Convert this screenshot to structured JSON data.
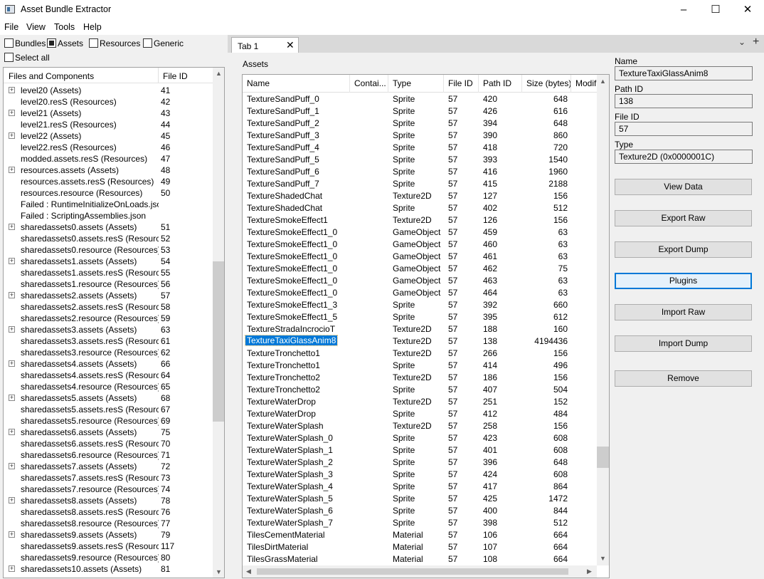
{
  "window": {
    "title": "Asset Bundle Extractor",
    "minimize": "–",
    "maximize": "☐",
    "close": "✕"
  },
  "menu": [
    "File",
    "View",
    "Tools",
    "Help"
  ],
  "filters": {
    "bundles": "Bundles",
    "assets": "Assets",
    "resources": "Resources",
    "generic": "Generic",
    "select_all": "Select all"
  },
  "tree": {
    "headers": {
      "name": "Files and Components",
      "fileid": "File ID"
    },
    "rows": [
      {
        "name": "level20 (Assets)",
        "id": "41",
        "exp": true
      },
      {
        "name": "level20.resS (Resources)",
        "id": "42",
        "exp": false
      },
      {
        "name": "level21 (Assets)",
        "id": "43",
        "exp": true
      },
      {
        "name": "level21.resS (Resources)",
        "id": "44",
        "exp": false
      },
      {
        "name": "level22 (Assets)",
        "id": "45",
        "exp": true
      },
      {
        "name": "level22.resS (Resources)",
        "id": "46",
        "exp": false
      },
      {
        "name": "modded.assets.resS (Resources)",
        "id": "47",
        "exp": false
      },
      {
        "name": "resources.assets (Assets)",
        "id": "48",
        "exp": true
      },
      {
        "name": "resources.assets.resS (Resources)",
        "id": "49",
        "exp": false
      },
      {
        "name": "resources.resource (Resources)",
        "id": "50",
        "exp": false
      },
      {
        "name": "Failed : RuntimeInitializeOnLoads.json",
        "id": "",
        "exp": false
      },
      {
        "name": "Failed : ScriptingAssemblies.json",
        "id": "",
        "exp": false
      },
      {
        "name": "sharedassets0.assets (Assets)",
        "id": "51",
        "exp": true
      },
      {
        "name": "sharedassets0.assets.resS (Resourc...",
        "id": "52",
        "exp": false
      },
      {
        "name": "sharedassets0.resource (Resources)",
        "id": "53",
        "exp": false
      },
      {
        "name": "sharedassets1.assets (Assets)",
        "id": "54",
        "exp": true
      },
      {
        "name": "sharedassets1.assets.resS (Resourc...",
        "id": "55",
        "exp": false
      },
      {
        "name": "sharedassets1.resource (Resources)",
        "id": "56",
        "exp": false
      },
      {
        "name": "sharedassets2.assets (Assets)",
        "id": "57",
        "exp": true
      },
      {
        "name": "sharedassets2.assets.resS (Resourc...",
        "id": "58",
        "exp": false
      },
      {
        "name": "sharedassets2.resource (Resources)",
        "id": "59",
        "exp": false
      },
      {
        "name": "sharedassets3.assets (Assets)",
        "id": "63",
        "exp": true
      },
      {
        "name": "sharedassets3.assets.resS (Resourc...",
        "id": "61",
        "exp": false
      },
      {
        "name": "sharedassets3.resource (Resources)",
        "id": "62",
        "exp": false
      },
      {
        "name": "sharedassets4.assets (Assets)",
        "id": "66",
        "exp": true
      },
      {
        "name": "sharedassets4.assets.resS (Resourc...",
        "id": "64",
        "exp": false
      },
      {
        "name": "sharedassets4.resource (Resources)",
        "id": "65",
        "exp": false
      },
      {
        "name": "sharedassets5.assets (Assets)",
        "id": "68",
        "exp": true
      },
      {
        "name": "sharedassets5.assets.resS (Resourc...",
        "id": "67",
        "exp": false
      },
      {
        "name": "sharedassets5.resource (Resources)",
        "id": "69",
        "exp": false
      },
      {
        "name": "sharedassets6.assets (Assets)",
        "id": "75",
        "exp": true
      },
      {
        "name": "sharedassets6.assets.resS (Resourc...",
        "id": "70",
        "exp": false
      },
      {
        "name": "sharedassets6.resource (Resources)",
        "id": "71",
        "exp": false
      },
      {
        "name": "sharedassets7.assets (Assets)",
        "id": "72",
        "exp": true
      },
      {
        "name": "sharedassets7.assets.resS (Resourc...",
        "id": "73",
        "exp": false
      },
      {
        "name": "sharedassets7.resource (Resources)",
        "id": "74",
        "exp": false
      },
      {
        "name": "sharedassets8.assets (Assets)",
        "id": "78",
        "exp": true
      },
      {
        "name": "sharedassets8.assets.resS (Resourc...",
        "id": "76",
        "exp": false
      },
      {
        "name": "sharedassets8.resource (Resources)",
        "id": "77",
        "exp": false
      },
      {
        "name": "sharedassets9.assets (Assets)",
        "id": "79",
        "exp": true
      },
      {
        "name": "sharedassets9.assets.resS (Resourc...",
        "id": "117",
        "exp": false
      },
      {
        "name": "sharedassets9.resource (Resources)",
        "id": "80",
        "exp": false
      },
      {
        "name": "sharedassets10.assets (Assets)",
        "id": "81",
        "exp": true
      }
    ]
  },
  "tab": {
    "label": "Tab 1",
    "close": "✕",
    "dropdown": "⌄",
    "add": "+"
  },
  "assets_label": "Assets",
  "table": {
    "headers": [
      "Name",
      "Contai...",
      "Type",
      "File ID",
      "Path ID",
      "Size (bytes)",
      "Modifi"
    ],
    "rows": [
      [
        "TextureSandPuff_0",
        "Sprite",
        "57",
        "420",
        "648"
      ],
      [
        "TextureSandPuff_1",
        "Sprite",
        "57",
        "426",
        "616"
      ],
      [
        "TextureSandPuff_2",
        "Sprite",
        "57",
        "394",
        "648"
      ],
      [
        "TextureSandPuff_3",
        "Sprite",
        "57",
        "390",
        "860"
      ],
      [
        "TextureSandPuff_4",
        "Sprite",
        "57",
        "418",
        "720"
      ],
      [
        "TextureSandPuff_5",
        "Sprite",
        "57",
        "393",
        "1540"
      ],
      [
        "TextureSandPuff_6",
        "Sprite",
        "57",
        "416",
        "1960"
      ],
      [
        "TextureSandPuff_7",
        "Sprite",
        "57",
        "415",
        "2188"
      ],
      [
        "TextureShadedChat",
        "Texture2D",
        "57",
        "127",
        "156"
      ],
      [
        "TextureShadedChat",
        "Sprite",
        "57",
        "402",
        "512"
      ],
      [
        "TextureSmokeEffect1",
        "Texture2D",
        "57",
        "126",
        "156"
      ],
      [
        "TextureSmokeEffect1_0",
        "GameObject",
        "57",
        "459",
        "63"
      ],
      [
        "TextureSmokeEffect1_0",
        "GameObject",
        "57",
        "460",
        "63"
      ],
      [
        "TextureSmokeEffect1_0",
        "GameObject",
        "57",
        "461",
        "63"
      ],
      [
        "TextureSmokeEffect1_0",
        "GameObject",
        "57",
        "462",
        "75"
      ],
      [
        "TextureSmokeEffect1_0",
        "GameObject",
        "57",
        "463",
        "63"
      ],
      [
        "TextureSmokeEffect1_0",
        "GameObject",
        "57",
        "464",
        "63"
      ],
      [
        "TextureSmokeEffect1_3",
        "Sprite",
        "57",
        "392",
        "660"
      ],
      [
        "TextureSmokeEffect1_5",
        "Sprite",
        "57",
        "395",
        "612"
      ],
      [
        "TextureStradaIncrocioT",
        "Texture2D",
        "57",
        "188",
        "160"
      ],
      [
        "TextureTaxiGlassAnim8",
        "Texture2D",
        "57",
        "138",
        "4194436"
      ],
      [
        "TextureTronchetto1",
        "Texture2D",
        "57",
        "266",
        "156"
      ],
      [
        "TextureTronchetto1",
        "Sprite",
        "57",
        "414",
        "496"
      ],
      [
        "TextureTronchetto2",
        "Texture2D",
        "57",
        "186",
        "156"
      ],
      [
        "TextureTronchetto2",
        "Sprite",
        "57",
        "407",
        "504"
      ],
      [
        "TextureWaterDrop",
        "Texture2D",
        "57",
        "251",
        "152"
      ],
      [
        "TextureWaterDrop",
        "Sprite",
        "57",
        "412",
        "484"
      ],
      [
        "TextureWaterSplash",
        "Texture2D",
        "57",
        "258",
        "156"
      ],
      [
        "TextureWaterSplash_0",
        "Sprite",
        "57",
        "423",
        "608"
      ],
      [
        "TextureWaterSplash_1",
        "Sprite",
        "57",
        "401",
        "608"
      ],
      [
        "TextureWaterSplash_2",
        "Sprite",
        "57",
        "396",
        "648"
      ],
      [
        "TextureWaterSplash_3",
        "Sprite",
        "57",
        "424",
        "608"
      ],
      [
        "TextureWaterSplash_4",
        "Sprite",
        "57",
        "417",
        "864"
      ],
      [
        "TextureWaterSplash_5",
        "Sprite",
        "57",
        "425",
        "1472"
      ],
      [
        "TextureWaterSplash_6",
        "Sprite",
        "57",
        "400",
        "844"
      ],
      [
        "TextureWaterSplash_7",
        "Sprite",
        "57",
        "398",
        "512"
      ],
      [
        "TilesCementMaterial",
        "Material",
        "57",
        "106",
        "664"
      ],
      [
        "TilesDirtMaterial",
        "Material",
        "57",
        "107",
        "664"
      ],
      [
        "TilesGrassMaterial",
        "Material",
        "57",
        "108",
        "664"
      ]
    ],
    "selected_index": 20
  },
  "info": {
    "name_label": "Name",
    "name_value": "TextureTaxiGlassAnim8",
    "path_label": "Path ID",
    "path_value": "138",
    "file_label": "File ID",
    "file_value": "57",
    "type_label": "Type",
    "type_value": "Texture2D (0x0000001C)"
  },
  "buttons": {
    "view_data": "View Data",
    "export_raw": "Export Raw",
    "export_dump": "Export Dump",
    "plugins": "Plugins",
    "import_raw": "Import Raw",
    "import_dump": "Import Dump",
    "remove": "Remove"
  },
  "colors": {
    "selection": "#0078d7",
    "panel": "#f0f0f0"
  }
}
